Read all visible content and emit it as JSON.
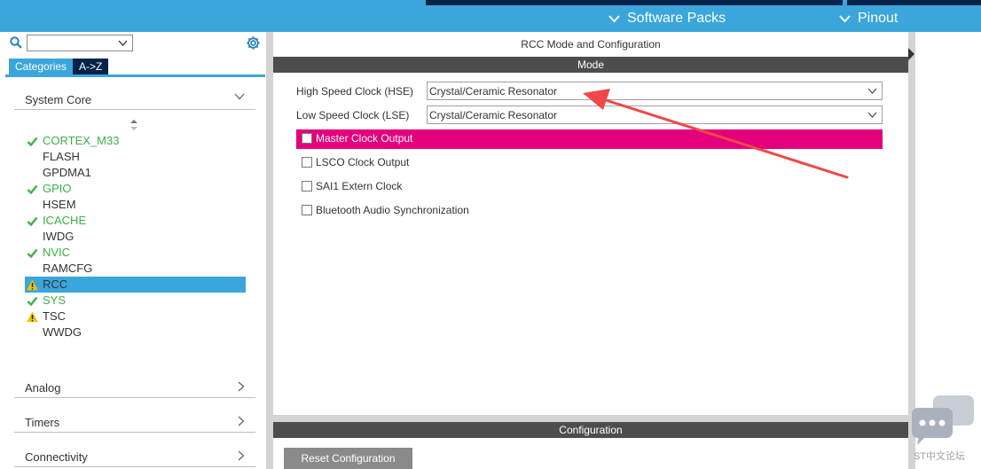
{
  "topbar": {
    "software_packs": "Software Packs",
    "pinout": "Pinout"
  },
  "sidebar": {
    "search_value": "",
    "tab_categories": "Categories",
    "tab_az": "A->Z",
    "system_core": "System Core",
    "items": [
      {
        "label": "CORTEX_M33",
        "status": "ok"
      },
      {
        "label": "FLASH",
        "status": "none"
      },
      {
        "label": "GPDMA1",
        "status": "none"
      },
      {
        "label": "GPIO",
        "status": "ok"
      },
      {
        "label": "HSEM",
        "status": "none"
      },
      {
        "label": "ICACHE",
        "status": "ok"
      },
      {
        "label": "IWDG",
        "status": "none"
      },
      {
        "label": "NVIC",
        "status": "ok"
      },
      {
        "label": "RAMCFG",
        "status": "none"
      },
      {
        "label": "RCC",
        "status": "warn"
      },
      {
        "label": "SYS",
        "status": "ok"
      },
      {
        "label": "TSC",
        "status": "warn"
      },
      {
        "label": "WWDG",
        "status": "none"
      }
    ],
    "categories": [
      "Analog",
      "Timers",
      "Connectivity"
    ]
  },
  "main": {
    "title": "RCC Mode and Configuration",
    "mode_header": "Mode",
    "hse_label": "High Speed Clock (HSE)",
    "hse_value": "Crystal/Ceramic Resonator",
    "lse_label": "Low Speed Clock (LSE)",
    "lse_value": "Crystal/Ceramic Resonator",
    "checkboxes": [
      {
        "label": "Master Clock Output",
        "checked": false
      },
      {
        "label": "LSCO Clock Output",
        "checked": false
      },
      {
        "label": "SAI1 Extern Clock",
        "checked": false
      },
      {
        "label": "Bluetooth Audio Synchronization",
        "checked": false
      }
    ],
    "config_header": "Configuration",
    "reset_button": "Reset Configuration"
  },
  "watermark": {
    "text": "ST中文论坛"
  },
  "colors": {
    "accent": "#3aa6db",
    "navy": "#03234b",
    "highlight": "#e4007c",
    "ok_green": "#3cb04a",
    "warn_yellow": "#f2c500",
    "annotation_red": "#f04747"
  }
}
